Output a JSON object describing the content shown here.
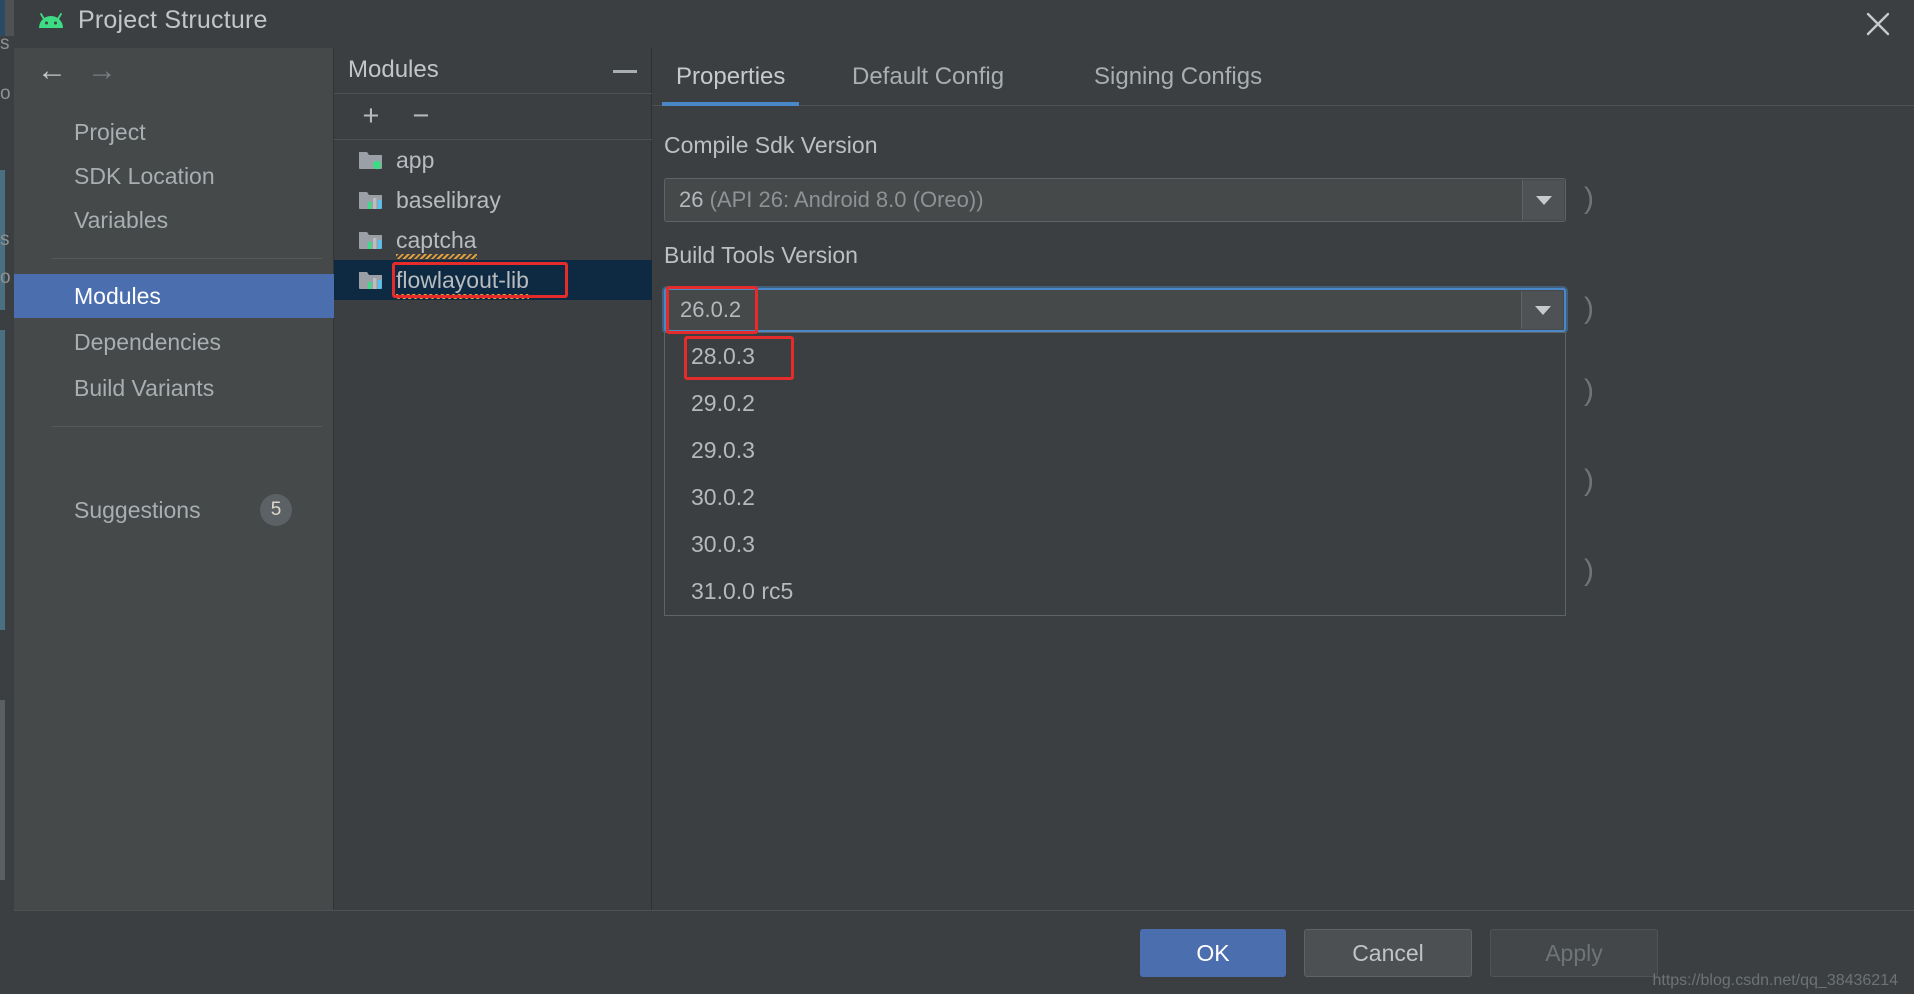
{
  "window": {
    "title": "Project Structure",
    "app_icon": "android-robot-icon",
    "close_icon": "close-icon"
  },
  "nav": {
    "back_icon": "arrow-left-icon",
    "forward_icon": "arrow-right-icon",
    "items": [
      {
        "label": "Project",
        "selected": false
      },
      {
        "label": "SDK Location",
        "selected": false
      },
      {
        "label": "Variables",
        "selected": false
      },
      {
        "label": "Modules",
        "selected": true
      },
      {
        "label": "Dependencies",
        "selected": false
      },
      {
        "label": "Build Variants",
        "selected": false
      },
      {
        "label": "Suggestions",
        "selected": false,
        "badge": "5"
      }
    ]
  },
  "modules": {
    "title": "Modules",
    "add_label": "+",
    "remove_label": "−",
    "collapse_icon": "collapse-icon",
    "items": [
      {
        "name": "app",
        "icon": "android-module-icon",
        "selected": false,
        "squiggle": false
      },
      {
        "name": "baselibray",
        "icon": "library-module-icon",
        "selected": false,
        "squiggle": false
      },
      {
        "name": "captcha",
        "icon": "library-module-icon",
        "selected": false,
        "squiggle": true
      },
      {
        "name": "flowlayout-lib",
        "icon": "library-module-icon",
        "selected": true,
        "squiggle": true
      }
    ]
  },
  "tabs": [
    {
      "label": "Properties",
      "active": true
    },
    {
      "label": "Default Config",
      "active": false
    },
    {
      "label": "Signing Configs",
      "active": false
    }
  ],
  "form": {
    "compile_sdk": {
      "label": "Compile Sdk Version",
      "value": "26",
      "value_detail": "(API 26: Android 8.0 (Oreo))"
    },
    "build_tools": {
      "label": "Build Tools Version",
      "value": "26.0.2",
      "options": [
        "28.0.3",
        "29.0.2",
        "29.0.3",
        "30.0.2",
        "30.0.3",
        "31.0.0 rc5"
      ],
      "highlighted_option": "28.0.3"
    },
    "bottom_combo_value": ""
  },
  "footer": {
    "ok": "OK",
    "cancel": "Cancel",
    "apply": "Apply"
  },
  "watermark": "https://blog.csdn.net/qq_38436214",
  "colors": {
    "accent": "#4b6eaf",
    "annotation": "#e62b2b",
    "selected_row": "#0d2a42",
    "android_green": "#3ddc84",
    "squiggle": "#e8a33d"
  }
}
